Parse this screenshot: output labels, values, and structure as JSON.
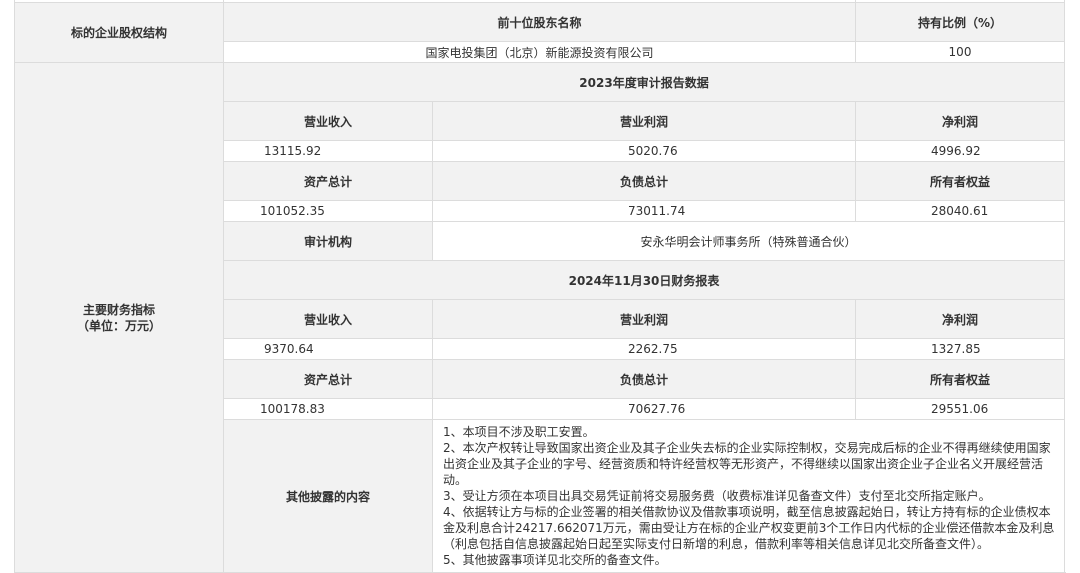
{
  "equity": {
    "label": "标的企业股权结构",
    "col_holder": "前十位股东名称",
    "col_ratio": "持有比例（%）",
    "holder": "国家电投集团（北京）新能源投资有限公司",
    "ratio": "100"
  },
  "finance": {
    "label_line1": "主要财务指标",
    "label_line2": "（单位：万元）",
    "audit2023": {
      "title": "2023年度审计报告数据",
      "revenue_label": "营业收入",
      "op_profit_label": "营业利润",
      "net_profit_label": "净利润",
      "revenue": "13115.92",
      "op_profit": "5020.76",
      "net_profit": "4996.92",
      "assets_label": "资产总计",
      "liabilities_label": "负债总计",
      "equity_label": "所有者权益",
      "assets": "101052.35",
      "liabilities": "73011.74",
      "owners_equity": "28040.61",
      "auditor_label": "审计机构",
      "auditor": "安永华明会计师事务所（特殊普通合伙）"
    },
    "report2024": {
      "title": "2024年11月30日财务报表",
      "revenue_label": "营业收入",
      "op_profit_label": "营业利润",
      "net_profit_label": "净利润",
      "revenue": "9370.64",
      "op_profit": "2262.75",
      "net_profit": "1327.85",
      "assets_label": "资产总计",
      "liabilities_label": "负债总计",
      "equity_label": "所有者权益",
      "assets": "100178.83",
      "liabilities": "70627.76",
      "owners_equity": "29551.06"
    }
  },
  "disclosure": {
    "label": "其他披露的内容",
    "items": [
      "1、本项目不涉及职工安置。",
      "2、本次产权转让导致国家出资企业及其子企业失去标的企业实际控制权，交易完成后标的企业不得再继续使用国家出资企业及其子企业的字号、经营资质和特许经营权等无形资产，不得继续以国家出资企业子企业名义开展经营活动。",
      "3、受让方须在本项目出具交易凭证前将交易服务费（收费标准详见备查文件）支付至北交所指定账户。",
      "4、依据转让方与标的企业签署的相关借款协议及借款事项说明，截至信息披露起始日，转让方持有标的企业债权本金及利息合计24217.662071万元，需由受让方在标的企业产权变更前3个工作日内代标的企业偿还借款本金及利息（利息包括自信息披露起始日起至实际支付日新增的利息，借款利率等相关信息详见北交所备查文件）。",
      "5、其他披露事项详见北交所的备查文件。"
    ]
  }
}
